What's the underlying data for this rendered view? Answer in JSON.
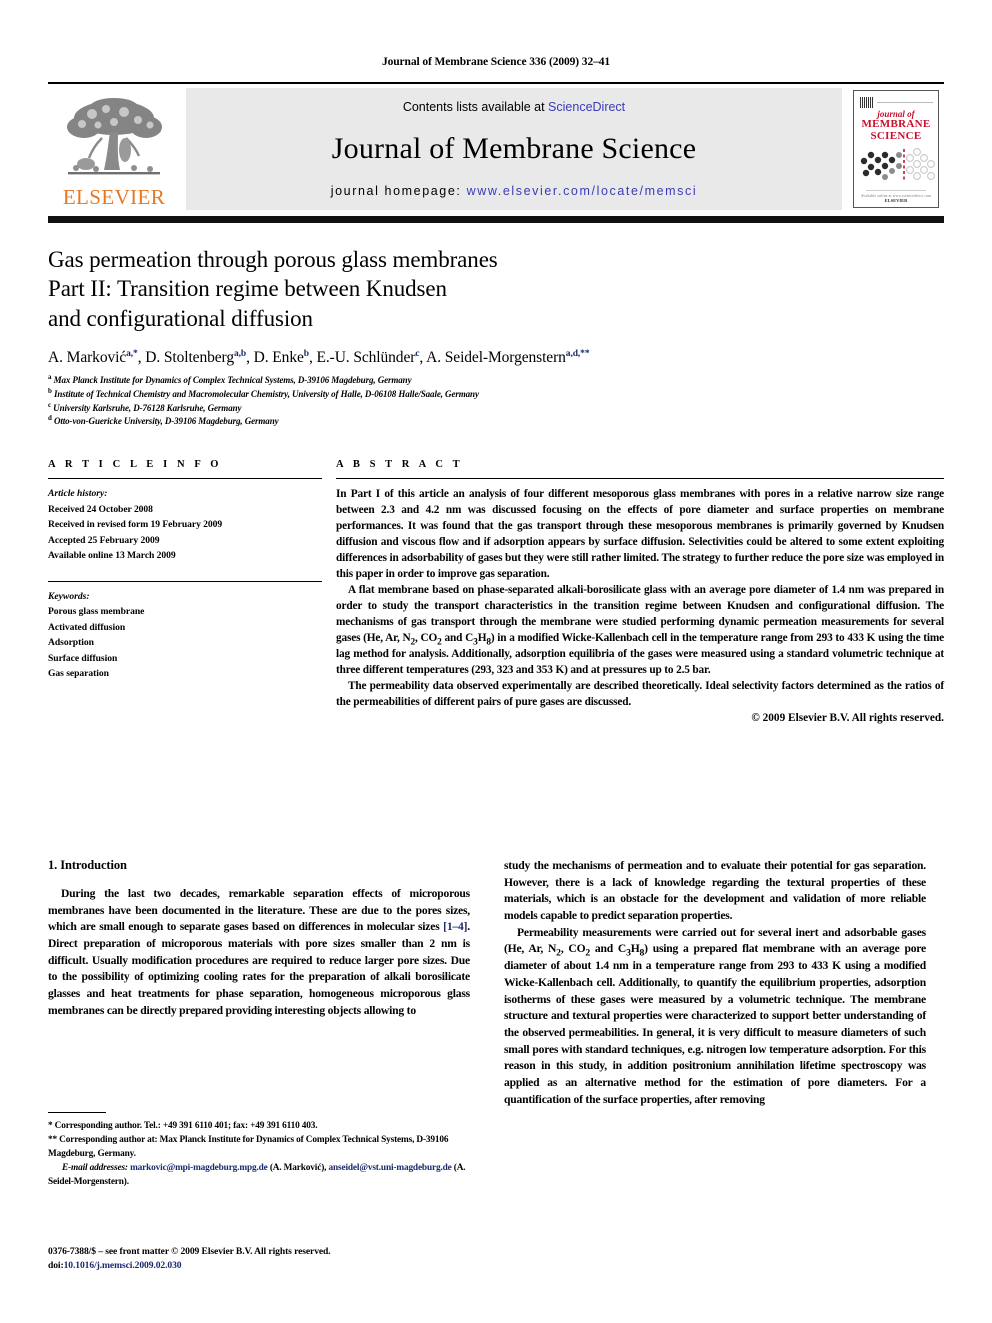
{
  "running_head": "Journal of Membrane Science 336 (2009) 32–41",
  "masthead": {
    "contents_prefix": "Contents lists available at ",
    "sciencedirect": "ScienceDirect",
    "journal_title": "Journal of Membrane Science",
    "homepage_prefix": "journal homepage: ",
    "homepage_url": "www.elsevier.com/locate/memsci",
    "publisher": "ELSEVIER",
    "accent_link_color": "#3b3bb8",
    "elsevier_orange": "#E87722",
    "cover": {
      "line1": "journal of",
      "line2": "MEMBRANE",
      "line3": "SCIENCE",
      "foot_small": "Available online at www.sciencedirect.com",
      "foot_brand": "ELSEVIER",
      "cover_red": "#c8102e"
    }
  },
  "article": {
    "title_line1": "Gas permeation through porous glass membranes",
    "title_line2": "Part II: Transition regime between Knudsen",
    "title_line3": "and configurational diffusion",
    "authors": [
      {
        "name": "A. Marković",
        "marks": "a,*"
      },
      {
        "name": "D. Stoltenberg",
        "marks": "a,b"
      },
      {
        "name": "D. Enke",
        "marks": "b"
      },
      {
        "name": "E.-U. Schlünder",
        "marks": "c"
      },
      {
        "name": "A. Seidel-Morgenstern",
        "marks": "a,d,**"
      }
    ],
    "affiliations": [
      {
        "mark": "a",
        "text": "Max Planck Institute for Dynamics of Complex Technical Systems, D-39106 Magdeburg, Germany"
      },
      {
        "mark": "b",
        "text": "Institute of Technical Chemistry and Macromolecular Chemistry, University of Halle, D-06108 Halle/Saale, Germany"
      },
      {
        "mark": "c",
        "text": "University Karlsruhe, D-76128 Karlsruhe, Germany"
      },
      {
        "mark": "d",
        "text": "Otto-von-Guericke University, D-39106 Magdeburg, Germany"
      }
    ]
  },
  "article_info": {
    "heading": "A R T I C L E   I N F O",
    "history_label": "Article history:",
    "history": [
      "Received 24 October 2008",
      "Received in revised form 19 February 2009",
      "Accepted 25 February 2009",
      "Available online 13 March 2009"
    ],
    "keywords_label": "Keywords:",
    "keywords": [
      "Porous glass membrane",
      "Activated diffusion",
      "Adsorption",
      "Surface diffusion",
      "Gas separation"
    ]
  },
  "abstract": {
    "heading": "A B S T R A C T",
    "paragraphs": [
      "In Part I of this article an analysis of four different mesoporous glass membranes with pores in a relative narrow size range between 2.3 and 4.2 nm was discussed focusing on the effects of pore diameter and surface properties on membrane performances. It was found that the gas transport through these mesoporous membranes is primarily governed by Knudsen diffusion and viscous flow and if adsorption appears by surface diffusion. Selectivities could be altered to some extent exploiting differences in adsorbability of gases but they were still rather limited. The strategy to further reduce the pore size was employed in this paper in order to improve gas separation.",
      "A flat membrane based on phase-separated alkali-borosilicate glass with an average pore diameter of 1.4 nm was prepared in order to study the transport characteristics in the transition regime between Knudsen and configurational diffusion. The mechanisms of gas transport through the membrane were studied performing dynamic permeation measurements for several gases (He, Ar, N2, CO2 and C3H8) in a modified Wicke-Kallenbach cell in the temperature range from 293 to 433 K using the time lag method for analysis. Additionally, adsorption equilibria of the gases were measured using a standard volumetric technique at three different temperatures (293, 323 and 353 K) and at pressures up to 2.5 bar.",
      "The permeability data observed experimentally are described theoretically. Ideal selectivity factors determined as the ratios of the permeabilities of different pairs of pure gases are discussed."
    ],
    "copyright": "© 2009 Elsevier B.V. All rights reserved."
  },
  "body": {
    "section_heading": "1. Introduction",
    "left_paragraph_a": "During the last two decades, remarkable separation effects of microporous membranes have been documented in the literature. These are due to the pores sizes, which are small enough to separate gases based on differences in molecular sizes ",
    "left_reference": "[1–4]",
    "left_paragraph_b": ". Direct preparation of microporous materials with pore sizes smaller than 2 nm is difficult. Usually modification procedures are required to reduce larger pore sizes. Due to the possibility of optimizing cooling rates for the preparation of alkali borosilicate glasses and heat treatments for phase separation, homogeneous microporous glass membranes can be directly prepared providing interesting objects allowing to",
    "right_paragraph_1": "study the mechanisms of permeation and to evaluate their potential for gas separation. However, there is a lack of knowledge regarding the textural properties of these materials, which is an obstacle for the development and validation of more reliable models capable to predict separation properties.",
    "right_paragraph_2": "Permeability measurements were carried out for several inert and adsorbable gases (He, Ar, N2, CO2 and C3H8) using a prepared flat membrane with an average pore diameter of about 1.4 nm in a temperature range from 293 to 433 K using a modified Wicke-Kallenbach cell. Additionally, to quantify the equilibrium properties, adsorption isotherms of these gases were measured by a volumetric technique. The membrane structure and textural properties were characterized to support better understanding of the observed permeabilities. In general, it is very difficult to measure diameters of such small pores with standard techniques, e.g. nitrogen low temperature adsorption. For this reason in this study, in addition positronium annihilation lifetime spectroscopy was applied as an alternative method for the estimation of pore diameters. For a quantification of the surface properties, after removing"
  },
  "footnotes": {
    "note1": "*  Corresponding author. Tel.: +49 391 6110 401; fax: +49 391 6110 403.",
    "note2": "**  Corresponding author at: Max Planck Institute for Dynamics of Complex Technical Systems, D-39106 Magdeburg, Germany.",
    "email_label": "E-mail addresses:",
    "email1": "markovic@mpi-magdeburg.mpg.de",
    "email1_name": " (A. Marković),",
    "email2": "anseidel@vst.uni-magdeburg.de",
    "email2_name": " (A. Seidel-Morgenstern).",
    "issn_line": "0376-7388/$ – see front matter © 2009 Elsevier B.V. All rights reserved.",
    "doi_label": "doi:",
    "doi_value": "10.1016/j.memsci.2009.02.030"
  }
}
